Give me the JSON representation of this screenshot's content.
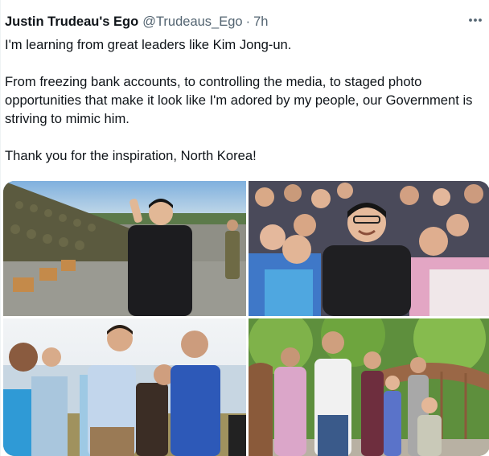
{
  "tweet": {
    "display_name": "Justin Trudeau's Ego",
    "handle": "@Trudeaus_Ego",
    "separator": "·",
    "time": "7h",
    "paragraphs": [
      "I'm learning from great leaders like Kim Jong-un.",
      "From freezing bank accounts, to controlling the media, to staged photo opportunities that make it look like I'm adored by my people, our Government is striving to mimic him.",
      "Thank you for the inspiration, North Korea!"
    ],
    "more_icon": "more-dots-icon"
  },
  "media": {
    "photos": [
      {
        "description_icon": "photo-icon"
      },
      {
        "description_icon": "photo-icon"
      },
      {
        "description_icon": "photo-icon"
      },
      {
        "description_icon": "photo-icon"
      }
    ]
  },
  "colors": {
    "text": "#0f1419",
    "secondary": "#536471",
    "border": "#eff3f4"
  }
}
